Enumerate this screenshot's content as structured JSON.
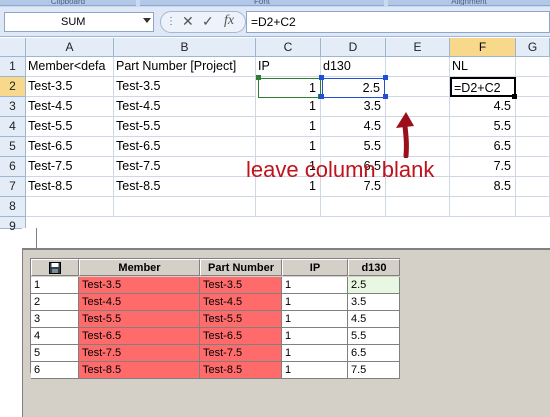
{
  "ribbon": {
    "groups": [
      "Clipboard",
      "Font",
      "Alignment"
    ]
  },
  "formula_bar": {
    "name_box": "SUM",
    "icons": [
      "cancel-icon",
      "enter-icon",
      "function-icon"
    ],
    "cancel_symbol": "✕",
    "enter_symbol": "✓",
    "fx_symbol": "fx",
    "formula": "=D2+C2"
  },
  "sheet": {
    "columns": [
      "A",
      "B",
      "C",
      "D",
      "E",
      "F",
      "G"
    ],
    "rows": [
      "1",
      "2",
      "3",
      "4",
      "5",
      "6",
      "7",
      "8",
      "9"
    ],
    "header_row": [
      "Member<defa",
      "Part Number [Project]",
      "IP",
      "d130",
      "",
      "NL"
    ],
    "data": [
      [
        "Test-3.5",
        "Test-3.5",
        "1",
        "2.5",
        "",
        "=D2+C2"
      ],
      [
        "Test-4.5",
        "Test-4.5",
        "1",
        "3.5",
        "",
        "4.5"
      ],
      [
        "Test-5.5",
        "Test-5.5",
        "1",
        "4.5",
        "",
        "5.5"
      ],
      [
        "Test-6.5",
        "Test-6.5",
        "1",
        "5.5",
        "",
        "6.5"
      ],
      [
        "Test-7.5",
        "Test-7.5",
        "1",
        "6.5",
        "",
        "7.5"
      ],
      [
        "Test-8.5",
        "Test-8.5",
        "1",
        "7.5",
        "",
        "8.5"
      ]
    ],
    "active_cell": "F2",
    "annotation": "leave column blank",
    "annotation_color": "#c0121c"
  },
  "param_table": {
    "headers": [
      "Member",
      "Part Number",
      "IP",
      "d130"
    ],
    "icon": "save-icon",
    "rows": [
      {
        "idx": "1",
        "member": "Test-3.5",
        "part": "Test-3.5",
        "ip": "1",
        "d130": "2.5"
      },
      {
        "idx": "2",
        "member": "Test-4.5",
        "part": "Test-4.5",
        "ip": "1",
        "d130": "3.5"
      },
      {
        "idx": "3",
        "member": "Test-5.5",
        "part": "Test-5.5",
        "ip": "1",
        "d130": "4.5"
      },
      {
        "idx": "4",
        "member": "Test-6.5",
        "part": "Test-6.5",
        "ip": "1",
        "d130": "5.5"
      },
      {
        "idx": "5",
        "member": "Test-7.5",
        "part": "Test-7.5",
        "ip": "1",
        "d130": "6.5"
      },
      {
        "idx": "6",
        "member": "Test-8.5",
        "part": "Test-8.5",
        "ip": "1",
        "d130": "7.5"
      }
    ]
  }
}
